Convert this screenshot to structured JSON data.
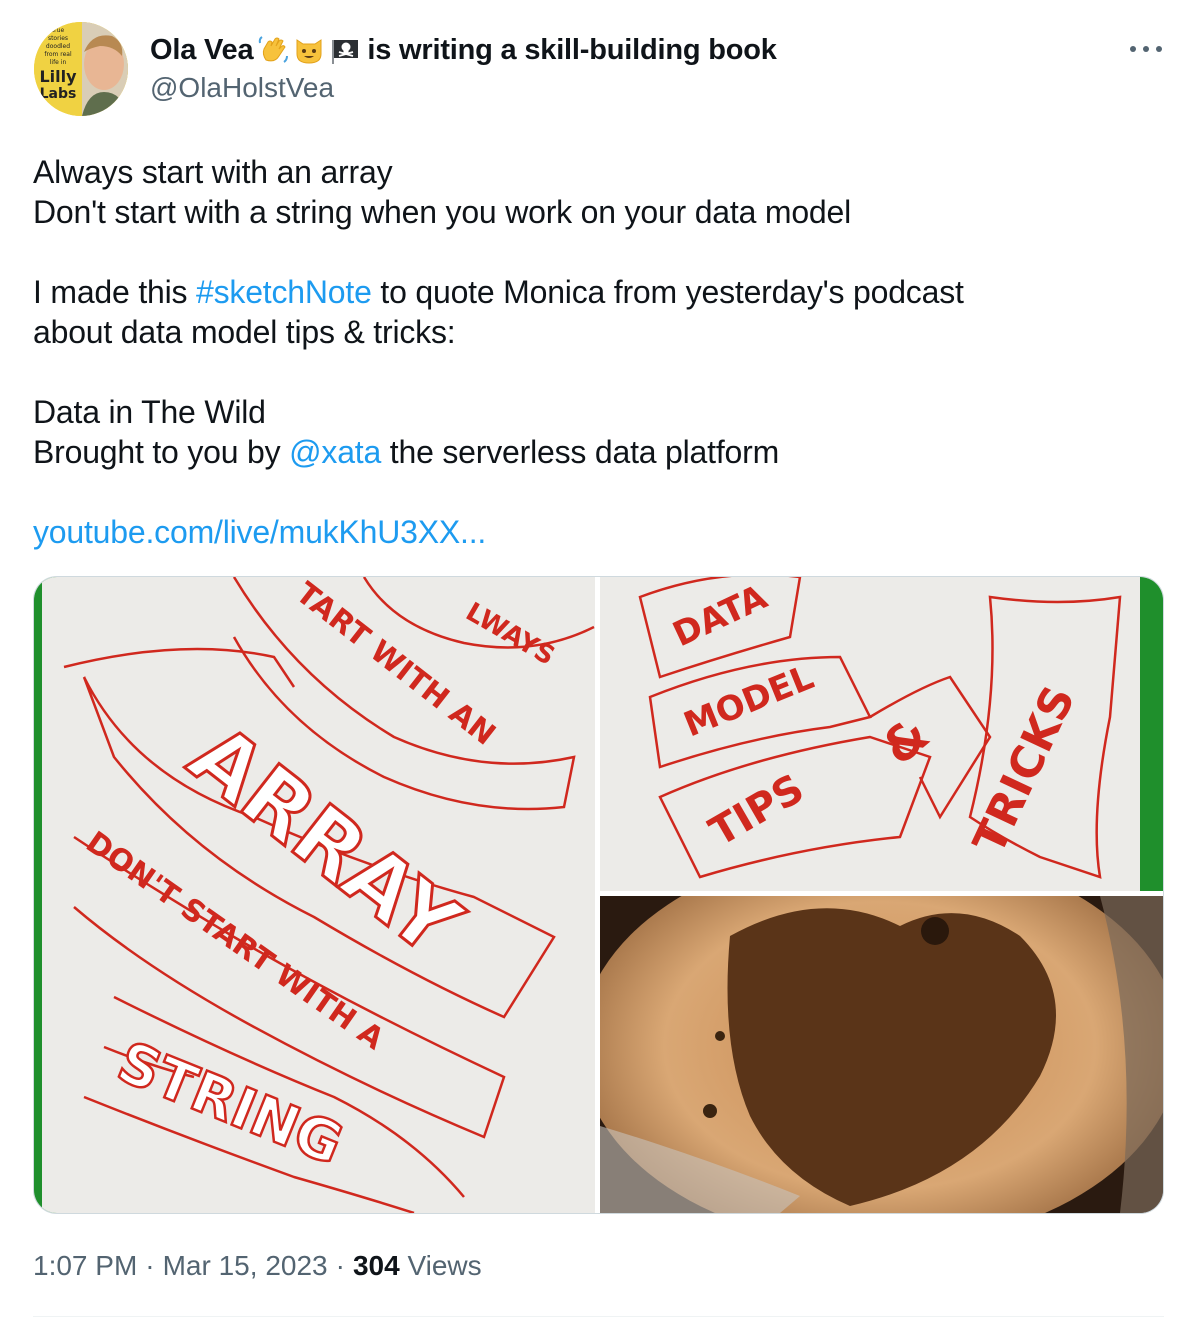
{
  "author": {
    "display_name": "Ola Vea",
    "name_suffix": "is writing a skill-building book",
    "handle": "@OlaHolstVea",
    "emojis": [
      "waving-hand-icon",
      "cat-face-icon",
      "pirate-flag-icon"
    ]
  },
  "avatar": {
    "badge_lines": [
      "true",
      "stories",
      "doodled",
      "from real",
      "life in",
      "Lilly",
      "Labs"
    ]
  },
  "tweet": {
    "line1": "Always start with an array",
    "line2": "Don't start with a string when you work on your data model",
    "line3_pre": "I made this ",
    "hashtag": "#sketchNote",
    "line3_post": " to quote Monica from yesterday's podcast",
    "line4": "about data model tips & tricks:",
    "line5": "Data in The Wild",
    "line6_pre": "Brought to you by ",
    "mention": "@xata",
    "line6_post": " the serverless data platform",
    "url": "youtube.com/live/mukKhU3XX..."
  },
  "media": {
    "left": {
      "words": [
        "LWAYS",
        "TART WITH AN",
        "ARRAY",
        "DON'T START WITH A",
        "STRING"
      ]
    },
    "top_right": {
      "words": [
        "DATA",
        "MODEL",
        "TIPS",
        "&",
        "TRICKS"
      ]
    }
  },
  "meta": {
    "time": "1:07 PM",
    "date": "Mar 15, 2023",
    "views_count": "304",
    "views_label": "Views",
    "separator": "·"
  },
  "colors": {
    "link": "#1d9bf0",
    "text": "#0f1419",
    "secondary": "#536471",
    "sketch_red": "#d0281e",
    "paper": "#ecebe8"
  }
}
